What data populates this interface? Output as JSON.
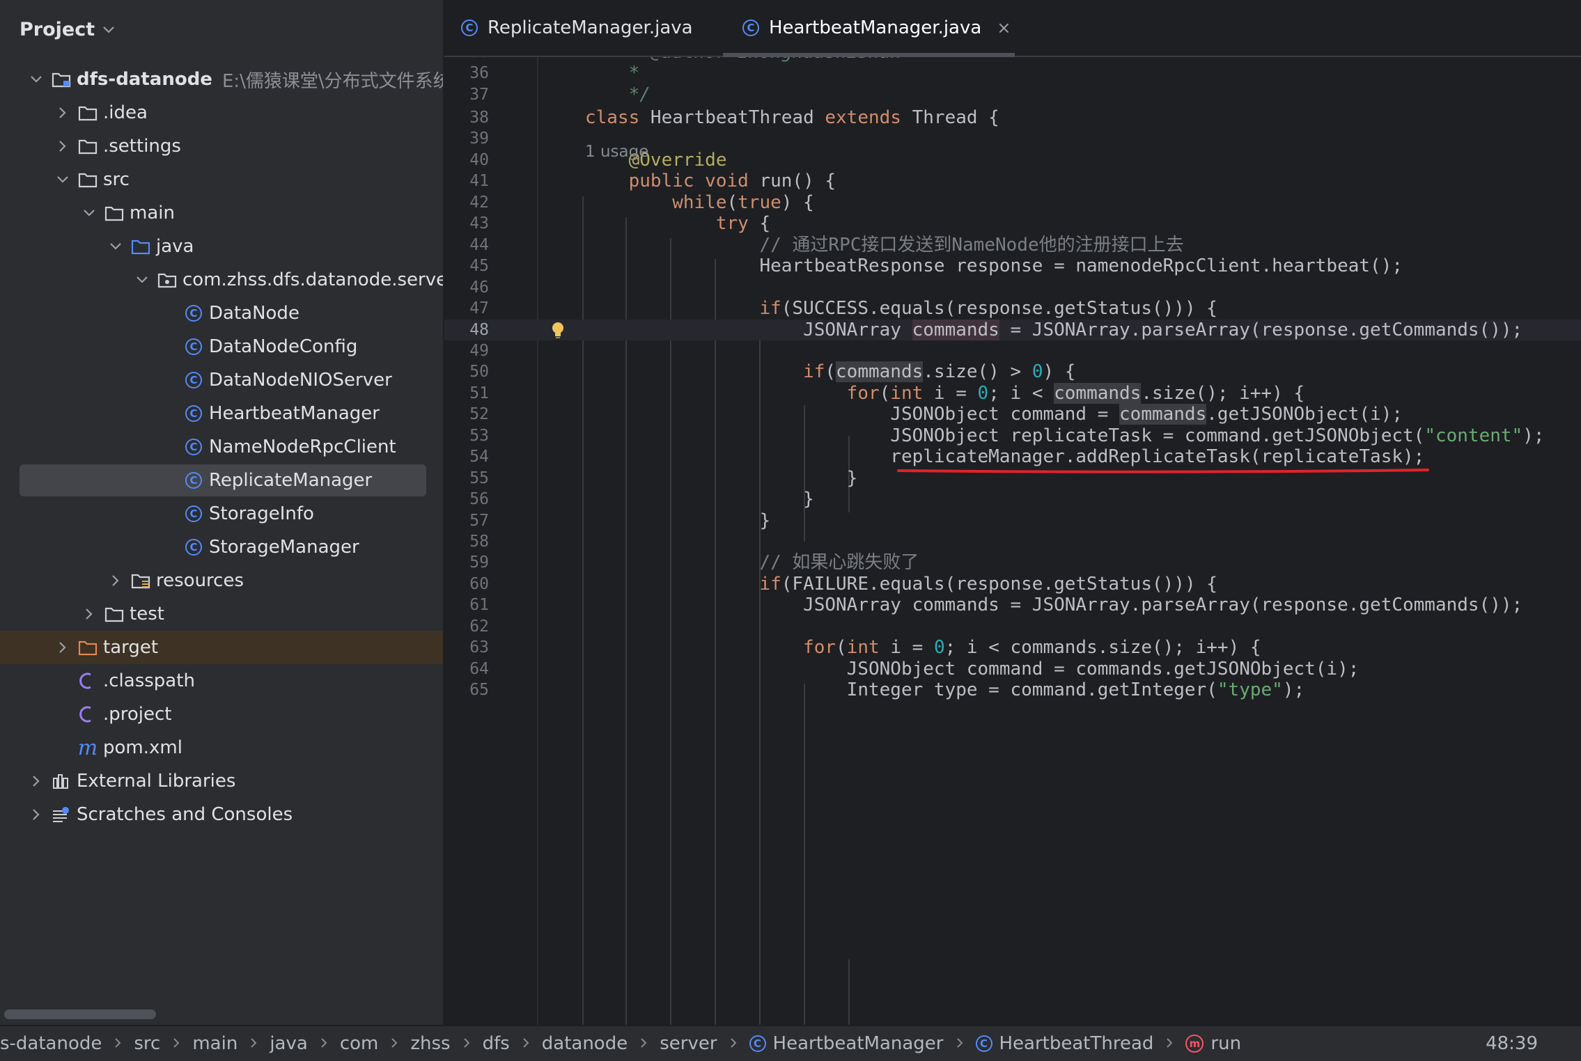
{
  "sidebar": {
    "title": "Project",
    "tree": [
      {
        "label": "dfs-datanode",
        "path": "E:\\儒猿课堂\\分布式文件系统\\",
        "icon": "module-folder-icon",
        "arrow": "expanded",
        "bold": true
      },
      {
        "label": ".idea",
        "icon": "folder-icon",
        "arrow": "collapsed"
      },
      {
        "label": ".settings",
        "icon": "folder-icon",
        "arrow": "collapsed"
      },
      {
        "label": "src",
        "icon": "folder-icon",
        "arrow": "expanded"
      },
      {
        "label": "main",
        "icon": "folder-icon",
        "arrow": "expanded"
      },
      {
        "label": "java",
        "icon": "source-folder-icon",
        "arrow": "expanded"
      },
      {
        "label": "com.zhss.dfs.datanode.server",
        "icon": "package-icon",
        "arrow": "expanded"
      },
      {
        "label": "DataNode",
        "icon": "class-icon"
      },
      {
        "label": "DataNodeConfig",
        "icon": "class-icon"
      },
      {
        "label": "DataNodeNIOServer",
        "icon": "class-icon"
      },
      {
        "label": "HeartbeatManager",
        "icon": "class-icon"
      },
      {
        "label": "NameNodeRpcClient",
        "icon": "class-icon"
      },
      {
        "label": "ReplicateManager",
        "icon": "class-icon",
        "selected": true
      },
      {
        "label": "StorageInfo",
        "icon": "class-icon"
      },
      {
        "label": "StorageManager",
        "icon": "class-icon"
      },
      {
        "label": "resources",
        "icon": "resources-folder-icon",
        "arrow": "collapsed"
      },
      {
        "label": "test",
        "icon": "folder-icon",
        "arrow": "collapsed"
      },
      {
        "label": "target",
        "icon": "excluded-folder-icon",
        "arrow": "collapsed",
        "excluded": true
      },
      {
        "label": ".classpath",
        "icon": "eclipse-file-icon"
      },
      {
        "label": ".project",
        "icon": "eclipse-file-icon"
      },
      {
        "label": "pom.xml",
        "icon": "maven-icon"
      },
      {
        "label": "External Libraries",
        "icon": "library-icon",
        "arrow": "collapsed"
      },
      {
        "label": "Scratches and Consoles",
        "icon": "scratches-icon",
        "arrow": "collapsed"
      }
    ]
  },
  "tabs": [
    {
      "label": "ReplicateManager.java",
      "active": false
    },
    {
      "label": "HeartbeatManager.java",
      "active": true,
      "close": "×"
    }
  ],
  "editor": {
    "inlay_hint": "1 usage",
    "lines": [
      {
        "n": "35",
        "tokens": [
          [
            "cmt-italic",
            "    * @author zhonghuashishan"
          ]
        ]
      },
      {
        "n": "36",
        "tokens": [
          [
            "cmt-italic",
            "    *"
          ]
        ]
      },
      {
        "n": "37",
        "tokens": [
          [
            "cmt-italic",
            "    */"
          ]
        ]
      },
      {
        "n": "38",
        "tokens": [
          [
            "kw",
            "class "
          ],
          [
            "",
            "HeartbeatThread "
          ],
          [
            "kw",
            "extends "
          ],
          [
            "",
            "Thread {"
          ]
        ]
      },
      {
        "n": "39",
        "tokens": []
      },
      {
        "n": "40",
        "tokens": [
          [
            "ann",
            "    @Override"
          ]
        ]
      },
      {
        "n": "41",
        "tokens": [
          [
            "kw",
            "    public void "
          ],
          [
            "",
            "run() {"
          ]
        ]
      },
      {
        "n": "42",
        "tokens": [
          [
            "kw",
            "        while"
          ],
          [
            "",
            "("
          ],
          [
            "kw",
            "true"
          ],
          [
            "",
            ") {"
          ]
        ]
      },
      {
        "n": "43",
        "tokens": [
          [
            "kw",
            "            try "
          ],
          [
            "",
            "{"
          ]
        ]
      },
      {
        "n": "44",
        "tokens": [
          [
            "cm",
            "                // 通过RPC接口发送到NameNode他的注册接口上去"
          ]
        ]
      },
      {
        "n": "45",
        "tokens": [
          [
            "",
            "                HeartbeatResponse response = namenodeRpcClient.heartbeat();"
          ]
        ]
      },
      {
        "n": "46",
        "tokens": []
      },
      {
        "n": "47",
        "tokens": [
          [
            "kw",
            "                if"
          ],
          [
            "",
            "(SUCCESS.equals(response.getStatus())) {"
          ]
        ]
      },
      {
        "n": "48",
        "tokens": [
          [
            "",
            "                    JSONArray "
          ],
          [
            "hl-cur",
            "commands"
          ],
          [
            "",
            " = JSONArray.parseArray(response.getCommands());"
          ]
        ],
        "current": true
      },
      {
        "n": "49",
        "tokens": []
      },
      {
        "n": "50",
        "tokens": [
          [
            "kw",
            "                    if"
          ],
          [
            "",
            "("
          ],
          [
            "hl",
            "commands"
          ],
          [
            "",
            ".size() > "
          ],
          [
            "num",
            "0"
          ],
          [
            "",
            ") {"
          ]
        ]
      },
      {
        "n": "51",
        "tokens": [
          [
            "kw",
            "                        for"
          ],
          [
            "",
            "("
          ],
          [
            "kw",
            "int "
          ],
          [
            "",
            "i = "
          ],
          [
            "num",
            "0"
          ],
          [
            "",
            "; i < "
          ],
          [
            "hl",
            "commands"
          ],
          [
            "",
            ".size(); i++) {"
          ]
        ]
      },
      {
        "n": "52",
        "tokens": [
          [
            "",
            "                            JSONObject command = "
          ],
          [
            "hl",
            "commands"
          ],
          [
            "",
            ".getJSONObject(i);"
          ]
        ]
      },
      {
        "n": "53",
        "tokens": [
          [
            "",
            "                            JSONObject replicateTask = command.getJSONObject("
          ],
          [
            "str",
            "\"content\""
          ],
          [
            "",
            ");"
          ]
        ]
      },
      {
        "n": "54",
        "tokens": [
          [
            "",
            "                            replicateManager.addReplicateTask(replicateTask);"
          ]
        ]
      },
      {
        "n": "55",
        "tokens": [
          [
            "",
            "                        }"
          ]
        ]
      },
      {
        "n": "56",
        "tokens": [
          [
            "",
            "                    }"
          ]
        ]
      },
      {
        "n": "57",
        "tokens": [
          [
            "",
            "                }"
          ]
        ]
      },
      {
        "n": "58",
        "tokens": []
      },
      {
        "n": "59",
        "tokens": [
          [
            "cm",
            "                // 如果心跳失败了"
          ]
        ]
      },
      {
        "n": "60",
        "tokens": [
          [
            "kw",
            "                if"
          ],
          [
            "",
            "(FAILURE.equals(response.getStatus())) {"
          ]
        ]
      },
      {
        "n": "61",
        "tokens": [
          [
            "",
            "                    JSONArray commands = JSONArray.parseArray(response.getCommands());"
          ]
        ]
      },
      {
        "n": "62",
        "tokens": []
      },
      {
        "n": "63",
        "tokens": [
          [
            "kw",
            "                    for"
          ],
          [
            "",
            "("
          ],
          [
            "kw",
            "int "
          ],
          [
            "",
            "i = "
          ],
          [
            "num",
            "0"
          ],
          [
            "",
            "; i < commands.size(); i++) {"
          ]
        ]
      },
      {
        "n": "64",
        "tokens": [
          [
            "",
            "                        JSONObject command = commands.getJSONObject(i);"
          ]
        ]
      },
      {
        "n": "65",
        "tokens": [
          [
            "",
            "                        Integer type = command.getInteger("
          ],
          [
            "str",
            "\"type\""
          ],
          [
            "",
            ");"
          ]
        ]
      }
    ]
  },
  "statusbar": {
    "crumbs": [
      {
        "label": "s-datanode"
      },
      {
        "label": "src"
      },
      {
        "label": "main"
      },
      {
        "label": "java"
      },
      {
        "label": "com"
      },
      {
        "label": "zhss"
      },
      {
        "label": "dfs"
      },
      {
        "label": "datanode"
      },
      {
        "label": "server"
      },
      {
        "label": "HeartbeatManager",
        "icon": "class-icon"
      },
      {
        "label": "HeartbeatThread",
        "icon": "class-icon"
      },
      {
        "label": "run",
        "icon": "method-icon"
      }
    ],
    "caret": "48:39"
  },
  "colors": {
    "accent": "#548af7",
    "keyword": "#cf8e6d",
    "string": "#6aab73",
    "number": "#2aacb8",
    "underline_red": "#e0232b"
  }
}
